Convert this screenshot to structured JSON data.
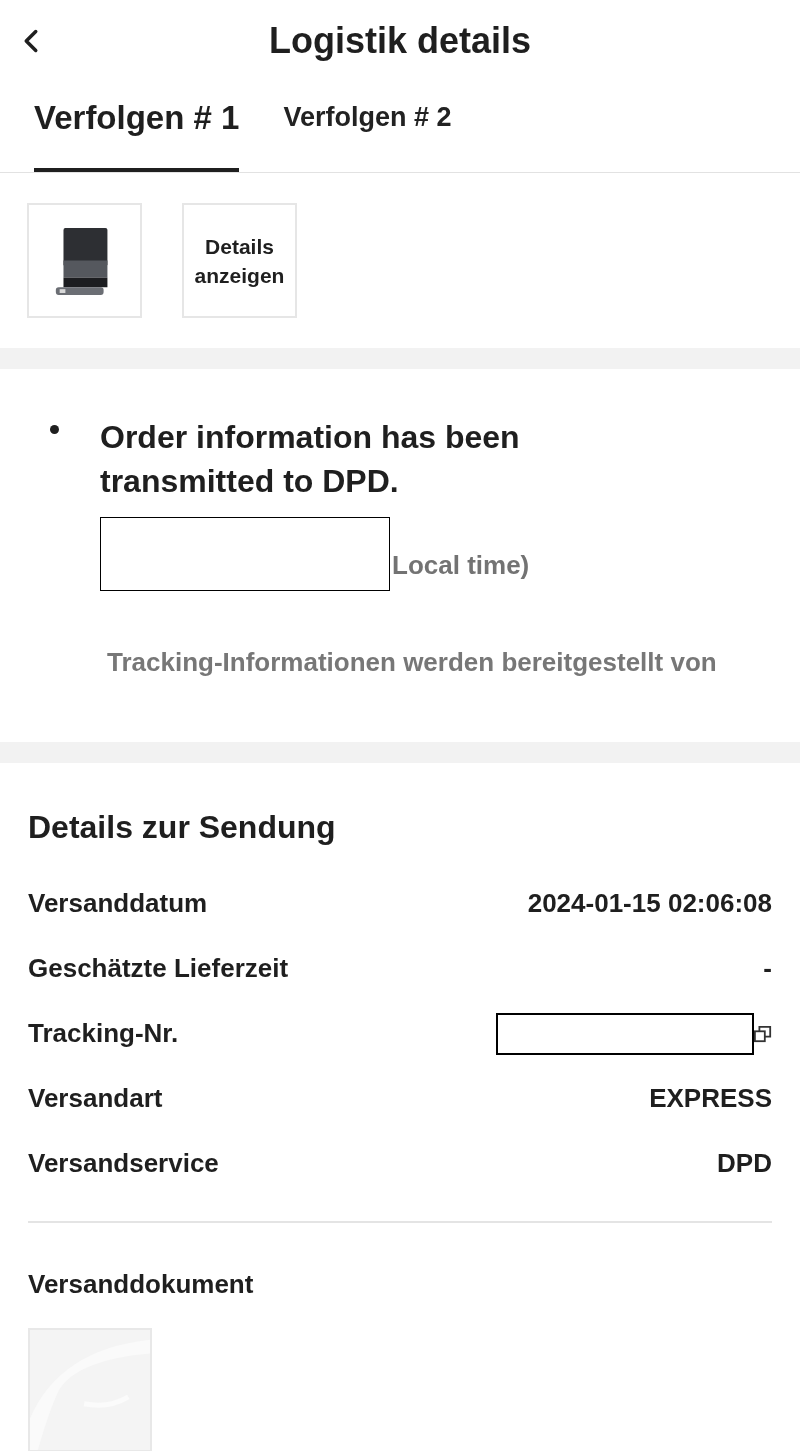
{
  "header": {
    "title": "Logistik details"
  },
  "tabs": [
    {
      "label": "Verfolgen # 1",
      "selected": true
    },
    {
      "label": "Verfolgen # 2",
      "selected": false
    }
  ],
  "package": {
    "details_button": "Details anzeigen"
  },
  "timeline": {
    "events": [
      {
        "status": "Order information has been transmitted to DPD.",
        "time_suffix": "Local time)"
      }
    ],
    "provider_note": "Tracking-Informationen werden bereitgestellt von"
  },
  "shipment": {
    "title": "Details zur Sendung",
    "rows": [
      {
        "label": "Versanddatum",
        "value": "2024-01-15 02:06:08",
        "kind": "text"
      },
      {
        "label": "Geschätzte Lieferzeit",
        "value": "-",
        "kind": "text"
      },
      {
        "label": "Tracking-Nr.",
        "kind": "redacted"
      },
      {
        "label": "Versandart",
        "value": "EXPRESS",
        "kind": "text"
      },
      {
        "label": "Versandservice",
        "value": "DPD",
        "kind": "text"
      }
    ],
    "document_title": "Versanddokument"
  }
}
